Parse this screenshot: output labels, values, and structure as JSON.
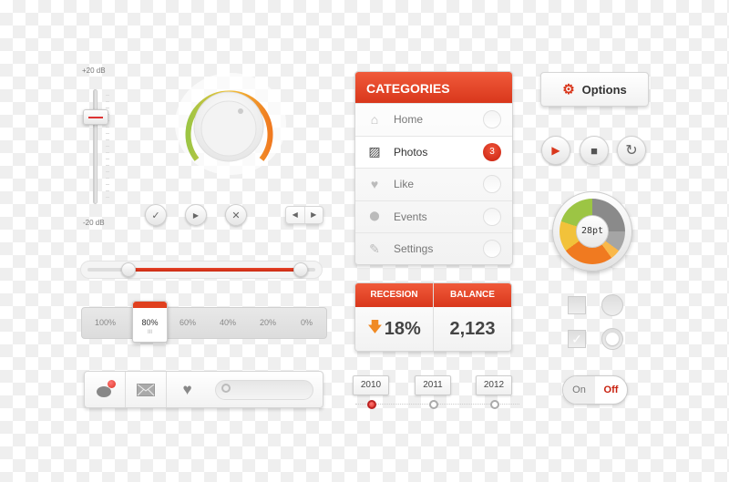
{
  "volume_slider": {
    "top_label": "+20 dB",
    "bottom_label": "-20 dB",
    "value_db": 10
  },
  "knob": {
    "level_fraction": 0.75
  },
  "small_buttons": [
    {
      "icon": "check-icon",
      "glyph": "✓"
    },
    {
      "icon": "play-icon",
      "glyph": "▶"
    },
    {
      "icon": "close-icon",
      "glyph": "✕"
    }
  ],
  "pager": {
    "prev": "◀",
    "next": "▶"
  },
  "range_slider": {
    "min_fraction": 0.2,
    "max_fraction": 0.92
  },
  "percent_selector": {
    "options": [
      "100%",
      "80%",
      "60%",
      "40%",
      "20%",
      "0%"
    ],
    "selected": "80%",
    "grip": "III"
  },
  "toolbar": {
    "search_placeholder": ""
  },
  "categories": {
    "title": "CATEGORIES",
    "items": [
      {
        "label": "Home",
        "icon": "home-icon",
        "glyph": "⌂",
        "active": false
      },
      {
        "label": "Photos",
        "icon": "image-icon",
        "glyph": "▨",
        "active": true,
        "badge": "3"
      },
      {
        "label": "Like",
        "icon": "heart-icon",
        "glyph": "♥",
        "active": false
      },
      {
        "label": "Events",
        "icon": "location-pin-icon",
        "glyph": "⬤",
        "active": false
      },
      {
        "label": "Settings",
        "icon": "wrench-icon",
        "glyph": "✎",
        "active": false
      }
    ]
  },
  "stats": {
    "recession_label": "RECESION",
    "recession_value": "18%",
    "recession_trend": "down",
    "balance_label": "BALANCE",
    "balance_value": "2,123"
  },
  "timeline": {
    "years": [
      "2010",
      "2011",
      "2012"
    ],
    "selected": "2010"
  },
  "options_button": {
    "label": "Options"
  },
  "media": {
    "play": "▶",
    "stop": "■",
    "refresh": "↻"
  },
  "gauge": {
    "label": "28pt"
  },
  "toggle": {
    "on": "On",
    "off": "Off",
    "state": "off"
  },
  "colors": {
    "accent": "#e0401f",
    "badge": "#d42a13",
    "orange": "#f08a24",
    "green": "#9cc544"
  }
}
